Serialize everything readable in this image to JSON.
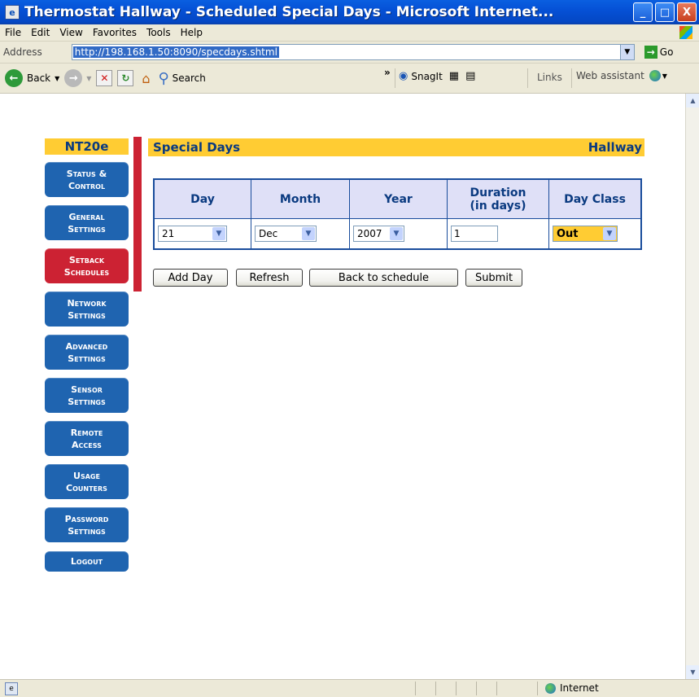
{
  "window": {
    "title": "Thermostat Hallway - Scheduled Special Days - Microsoft Internet...",
    "minimize": "_",
    "maximize": "□",
    "close": "X"
  },
  "menu": [
    "File",
    "Edit",
    "View",
    "Favorites",
    "Tools",
    "Help"
  ],
  "address": {
    "label": "Address",
    "url": "http://198.168.1.50:8090/specdays.shtml",
    "go_label": "Go"
  },
  "toolbar": {
    "back": "Back",
    "search": "Search",
    "snagit": "SnagIt",
    "links": "Links",
    "web_assistant": "Web assistant",
    "more": "»"
  },
  "sidebar": {
    "title": "NT20e",
    "items": [
      {
        "line1": "Status &",
        "line2": "Control"
      },
      {
        "line1": "General",
        "line2": "Settings"
      },
      {
        "line1": "Setback",
        "line2": "Schedules"
      },
      {
        "line1": "Network",
        "line2": "Settings"
      },
      {
        "line1": "Advanced",
        "line2": "Settings"
      },
      {
        "line1": "Sensor",
        "line2": "Settings"
      },
      {
        "line1": "Remote",
        "line2": "Access"
      },
      {
        "line1": "Usage",
        "line2": "Counters"
      },
      {
        "line1": "Password",
        "line2": "Settings"
      },
      {
        "line1": "Logout",
        "line2": ""
      }
    ],
    "active_index": 2
  },
  "panel": {
    "title": "Special Days",
    "location": "Hallway"
  },
  "table": {
    "headers": [
      "Day",
      "Month",
      "Year",
      "Duration (in days)",
      "Day Class"
    ],
    "header_duration_line1": "Duration",
    "header_duration_line2": "(in days)",
    "row": {
      "day": "21",
      "month": "Dec",
      "year": "2007",
      "duration": "1",
      "day_class": "Out"
    }
  },
  "buttons": {
    "add_day": "Add Day",
    "refresh": "Refresh",
    "back_to_schedule": "Back to schedule",
    "submit": "Submit"
  },
  "status": {
    "zone": "Internet"
  },
  "colors": {
    "header_yellow": "#ffcc33",
    "nav_blue": "#1f64b0",
    "nav_active_red": "#cc2233",
    "table_header_bg": "#dfe0f7",
    "table_border": "#1a4d9c"
  }
}
